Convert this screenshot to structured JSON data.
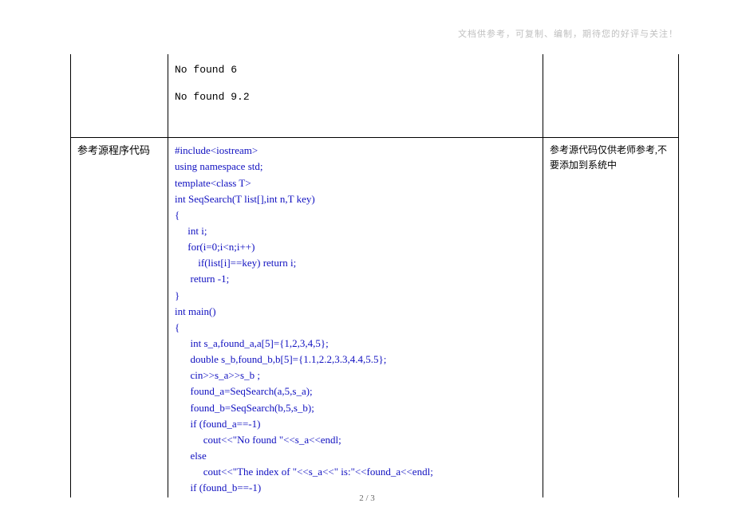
{
  "header_note": "文档供参考，可复制、编制，期待您的好评与关注！",
  "row1": {
    "label": "",
    "output_line1": "No found 6",
    "output_line2": "No found 9.2",
    "note": ""
  },
  "row2": {
    "label": "参考源程序代码",
    "note": "参考源代码仅供老师参考,不要添加到系统中",
    "code": {
      "l0": "#include<iostream>",
      "l1": "using namespace std;",
      "l2": "template<class T>",
      "l3": "int SeqSearch(T list[],int n,T key)",
      "l4": "{",
      "l5": "     int i;",
      "l6": "     for(i=0;i<n;i++)",
      "l7": "         if(list[i]==key) return i;",
      "l8": "      return -1;",
      "l9": "}",
      "l10": "int main()",
      "l11": "{",
      "l12": "      int s_a,found_a,a[5]={1,2,3,4,5};",
      "l13": "      double s_b,found_b,b[5]={1.1,2.2,3.3,4.4,5.5};",
      "l14": "      cin>>s_a>>s_b ;",
      "l15": "      found_a=SeqSearch(a,5,s_a);",
      "l16": "      found_b=SeqSearch(b,5,s_b);",
      "l17": "      if (found_a==-1)",
      "l18": "           cout<<\"No found \"<<s_a<<endl;",
      "l19": "      else",
      "l20": "           cout<<\"The index of \"<<s_a<<\" is:\"<<found_a<<endl;",
      "l21": "      if (found_b==-1)"
    }
  },
  "page_num": "2 / 3"
}
